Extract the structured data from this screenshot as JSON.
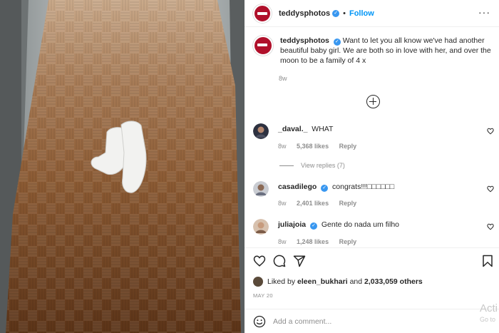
{
  "post": {
    "author": "teddysphotos",
    "follow_label": "Follow",
    "caption_text": "Want to let you all know we've had another beautiful baby girl. We are both so in love with her, and over the moon to be a family of 4 x",
    "caption_time": "8w"
  },
  "comments": [
    {
      "username": "_daval._",
      "verified": false,
      "text": "WHAT",
      "time": "8w",
      "likes": "5,368 likes",
      "reply": "Reply"
    },
    {
      "username": "casadilego",
      "verified": true,
      "text": "congrats!!!□□□□□□",
      "time": "8w",
      "likes": "2,401 likes",
      "reply": "Reply"
    },
    {
      "username": "juliajoia",
      "verified": true,
      "text": "Gente do nada um filho",
      "time": "8w",
      "likes": "1,248 likes",
      "reply": "Reply"
    }
  ],
  "view_replies": "View replies (7)",
  "likes": {
    "prefix": "Liked by",
    "user": "eleen_bukhari",
    "joiner": "and",
    "count": "2,033,059 others"
  },
  "date": "MAY 20",
  "add_comment": {
    "placeholder": "Add a comment..."
  },
  "watermark": {
    "line1": "Acti",
    "line2": "Go to"
  },
  "icons": [
    "more-icon",
    "plus-circle-icon",
    "heart-icon",
    "comment-icon",
    "share-icon",
    "bookmark-icon",
    "emoji-icon",
    "verified-icon"
  ],
  "colors": {
    "link": "#0095f6",
    "verified": "#3897f0",
    "muted": "#8e8e8e",
    "text": "#262626"
  }
}
